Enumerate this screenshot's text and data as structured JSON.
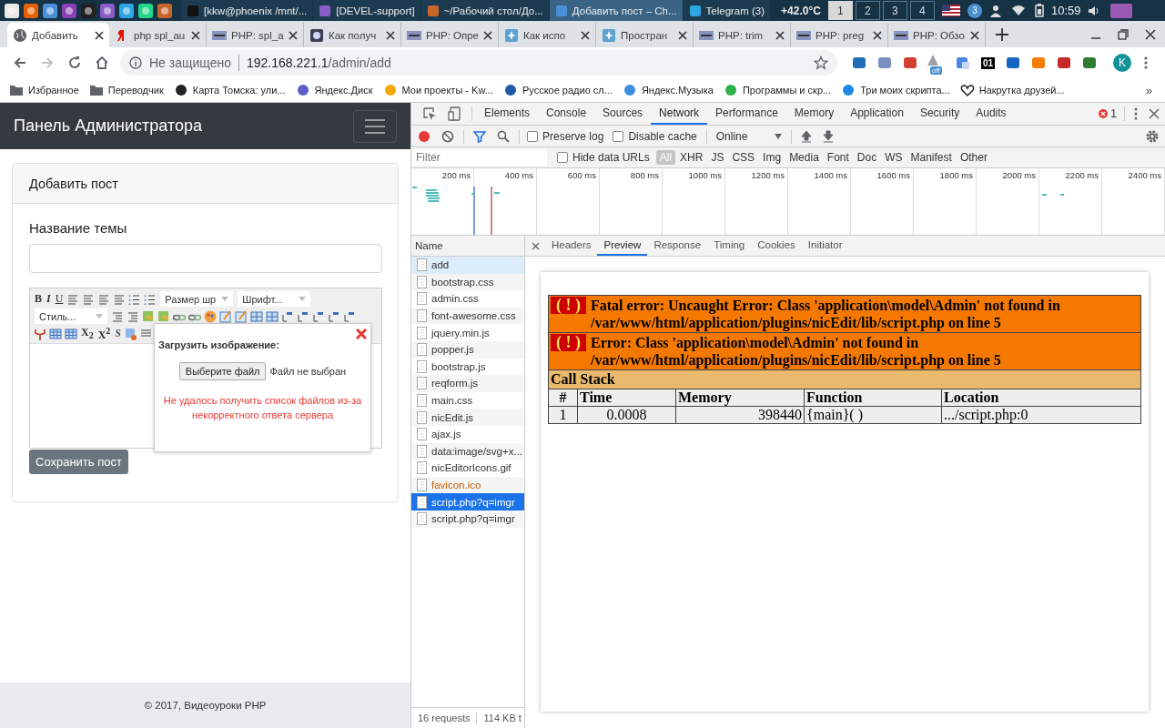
{
  "taskbar": {
    "tasks": [
      {
        "label": "[kkw@phoenix /mnt/...",
        "kind": "terminal",
        "selected": false
      },
      {
        "label": "[DEVEL-support]",
        "kind": "folder",
        "selected": false
      },
      {
        "label": "~/Рабочий стол/До...",
        "kind": "editor",
        "selected": false
      },
      {
        "label": "Добавить пост – Ch...",
        "kind": "browser",
        "selected": true
      },
      {
        "label": "Telegram (3)",
        "kind": "telegram",
        "selected": false
      }
    ],
    "temperature": "+42.0°C",
    "workspaces": [
      {
        "label": "1",
        "selected": true
      },
      {
        "label": "2",
        "selected": false
      },
      {
        "label": "3",
        "selected": false
      },
      {
        "label": "4",
        "selected": false
      }
    ],
    "notification_count": "3",
    "clock": "10:59"
  },
  "browser": {
    "tabs": [
      {
        "title": "Добавить",
        "kind": "globe",
        "selected": true
      },
      {
        "title": "php spl_au",
        "kind": "yandex",
        "selected": false
      },
      {
        "title": "PHP: spl_a",
        "kind": "php",
        "selected": false
      },
      {
        "title": "Как получ",
        "kind": "dark",
        "selected": false
      },
      {
        "title": "PHP: Опре",
        "kind": "php",
        "selected": false
      },
      {
        "title": "Как испо",
        "kind": "star",
        "selected": false
      },
      {
        "title": "Простран",
        "kind": "star",
        "selected": false
      },
      {
        "title": "PHP: trim",
        "kind": "php",
        "selected": false
      },
      {
        "title": "PHP: preg",
        "kind": "php",
        "selected": false
      },
      {
        "title": "PHP: Обзо",
        "kind": "php",
        "selected": false
      }
    ],
    "security_label": "Не защищено",
    "url_host": "192.168.221.1",
    "url_path": "/admin/add",
    "extension_badge": "off",
    "extension_counter": "01",
    "account_initial": "K",
    "bookmarks": [
      {
        "label": "Избранное",
        "kind": "folder"
      },
      {
        "label": "Переводчик",
        "kind": "folder"
      },
      {
        "label": "Карта Томска: ули...",
        "kind": "site"
      },
      {
        "label": "Яндекс.Диск",
        "kind": "site"
      },
      {
        "label": "Мои проекты - Kw...",
        "kind": "site"
      },
      {
        "label": "Русское радио сл...",
        "kind": "site"
      },
      {
        "label": "Яндекс.Музыка",
        "kind": "site"
      },
      {
        "label": "Программы и скр...",
        "kind": "site"
      },
      {
        "label": "Три моих скрипта...",
        "kind": "site"
      },
      {
        "label": "Накрутка  друзей...",
        "kind": "heart"
      }
    ],
    "bookmarks_more": "»"
  },
  "page": {
    "brand": "Панель Администратора",
    "card_title": "Добавить пост",
    "field_label": "Название темы",
    "toolbar": {
      "format_buttons": [
        {
          "label": "B",
          "kind": "bold"
        },
        {
          "label": "I",
          "kind": "italic"
        },
        {
          "label": "U",
          "kind": "underline"
        }
      ],
      "size_select": "Размер шр",
      "font_select": "Шрифт...",
      "style_select": "Стиль...",
      "script_buttons": [
        {
          "label": "X$_{2}$",
          "kind": "plain"
        },
        {
          "label": "X$^{2}$",
          "kind": "plain"
        },
        {
          "label": "S",
          "kind": "strike"
        }
      ]
    },
    "upload_dialog": {
      "title": "Загрузить изображение:",
      "choose_button": "Выберите файл",
      "file_status": "Файл не выбран",
      "error": "Не удалось получить список файлов из-за некорректного ответа сервера"
    },
    "save_button": "Сохранить пост",
    "footer": "© 2017, Видеоуроки PHP"
  },
  "devtools": {
    "panels": [
      {
        "label": "Elements",
        "selected": false
      },
      {
        "label": "Console",
        "selected": false
      },
      {
        "label": "Sources",
        "selected": false
      },
      {
        "label": "Network",
        "selected": true
      },
      {
        "label": "Performance",
        "selected": false
      },
      {
        "label": "Memory",
        "selected": false
      },
      {
        "label": "Application",
        "selected": false
      },
      {
        "label": "Security",
        "selected": false
      },
      {
        "label": "Audits",
        "selected": false
      }
    ],
    "error_count": "1",
    "toolbar": {
      "recording": true,
      "preserve_log": {
        "label": "Preserve log",
        "checked": false
      },
      "disable_cache": {
        "label": "Disable cache",
        "checked": false
      },
      "throttling": "Online"
    },
    "filter": {
      "placeholder": "Filter",
      "hide_data_urls": {
        "label": "Hide data URLs",
        "checked": false
      },
      "types": [
        {
          "label": "All",
          "selected": true
        },
        {
          "label": "XHR",
          "selected": false
        },
        {
          "label": "JS",
          "selected": false
        },
        {
          "label": "CSS",
          "selected": false
        },
        {
          "label": "Img",
          "selected": false
        },
        {
          "label": "Media",
          "selected": false
        },
        {
          "label": "Font",
          "selected": false
        },
        {
          "label": "Doc",
          "selected": false
        },
        {
          "label": "WS",
          "selected": false
        },
        {
          "label": "Manifest",
          "selected": false
        },
        {
          "label": "Other",
          "selected": false
        }
      ]
    },
    "overview_ticks": [
      "200 ms",
      "400 ms",
      "600 ms",
      "800 ms",
      "1000 ms",
      "1200 ms",
      "1400 ms",
      "1600 ms",
      "1800 ms",
      "2000 ms",
      "2200 ms",
      "2400 ms"
    ],
    "requests_header": "Name",
    "requests": [
      {
        "name": "add",
        "hovered": true,
        "selected": false,
        "failed": false
      },
      {
        "name": "bootstrap.css",
        "hovered": false,
        "selected": false,
        "failed": false
      },
      {
        "name": "admin.css",
        "hovered": false,
        "selected": false,
        "failed": false
      },
      {
        "name": "font-awesome.css",
        "hovered": false,
        "selected": false,
        "failed": false
      },
      {
        "name": "jquery.min.js",
        "hovered": false,
        "selected": false,
        "failed": false
      },
      {
        "name": "popper.js",
        "hovered": false,
        "selected": false,
        "failed": false
      },
      {
        "name": "bootstrap.js",
        "hovered": false,
        "selected": false,
        "failed": false
      },
      {
        "name": "reqform.js",
        "hovered": false,
        "selected": false,
        "failed": false
      },
      {
        "name": "main.css",
        "hovered": false,
        "selected": false,
        "failed": false
      },
      {
        "name": "nicEdit.js",
        "hovered": false,
        "selected": false,
        "failed": false
      },
      {
        "name": "ajax.js",
        "hovered": false,
        "selected": false,
        "failed": false
      },
      {
        "name": "data:image/svg+x...",
        "hovered": false,
        "selected": false,
        "failed": false
      },
      {
        "name": "nicEditorIcons.gif",
        "hovered": false,
        "selected": false,
        "failed": false
      },
      {
        "name": "favicon.ico",
        "hovered": false,
        "selected": false,
        "failed": true
      },
      {
        "name": "script.php?q=imgr",
        "hovered": false,
        "selected": true,
        "failed": false
      },
      {
        "name": "script.php?q=imgr",
        "hovered": false,
        "selected": false,
        "failed": false
      }
    ],
    "summary": [
      "16 requests",
      "114 KB t"
    ],
    "detail_tabs": [
      {
        "label": "Headers",
        "selected": false
      },
      {
        "label": "Preview",
        "selected": true
      },
      {
        "label": "Response",
        "selected": false
      },
      {
        "label": "Timing",
        "selected": false
      },
      {
        "label": "Cookies",
        "selected": false
      },
      {
        "label": "Initiator",
        "selected": false
      }
    ],
    "preview": {
      "errors": [
        {
          "icon": "( ! )",
          "message": "Fatal error: Uncaught Error: Class 'application\\model\\Admin' not found in /var/www/html/application/plugins/nicEdit/lib/script.php on line 5"
        },
        {
          "icon": "( ! )",
          "message": "Error: Class 'application\\model\\Admin' not found in /var/www/html/application/plugins/nicEdit/lib/script.php on line 5"
        }
      ],
      "call_stack_title": "Call Stack",
      "columns": [
        "#",
        "Time",
        "Memory",
        "Function",
        "Location"
      ],
      "rows": [
        [
          "1",
          "0.0008",
          "398440",
          "{main}( )",
          ".../script.php:0"
        ]
      ]
    }
  }
}
